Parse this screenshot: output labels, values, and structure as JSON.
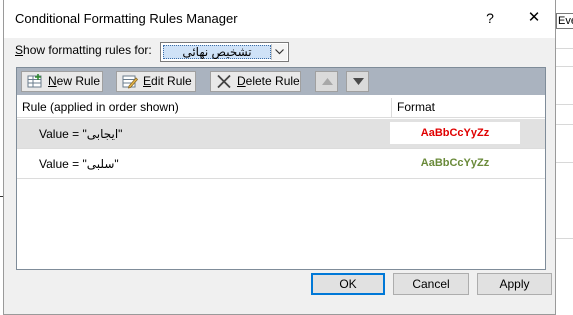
{
  "background": {
    "cell_text": "Eve"
  },
  "dialog": {
    "title": "Conditional Formatting Rules Manager",
    "help_label": "?",
    "close_label": "✕",
    "show_rules_label": "Show formatting rules for:",
    "show_rules_value": "تشخیص نهائی"
  },
  "toolbar": {
    "new_rule": "New Rule",
    "edit_rule": "Edit Rule",
    "delete_rule": "Delete Rule",
    "move_up_icon": "arrow-up-icon",
    "move_down_icon": "arrow-down-icon"
  },
  "table": {
    "columns": [
      "Rule (applied in order shown)",
      "Format"
    ],
    "rows": [
      {
        "rule": "Value = \"ایجابی\"",
        "preview": "AaBbCcYyZz",
        "preview_color": "#e00000",
        "selected": true
      },
      {
        "rule": "Value = \"سلبی\"",
        "preview": "AaBbCcYyZz",
        "preview_color": "#6a8a3a",
        "selected": false
      }
    ]
  },
  "buttons": {
    "ok": "OK",
    "cancel": "Cancel",
    "apply": "Apply"
  },
  "colors": {
    "toolbar_bg": "#aab3bf",
    "selected_row": "#e1e1e1",
    "focus_border": "#0078d7"
  }
}
